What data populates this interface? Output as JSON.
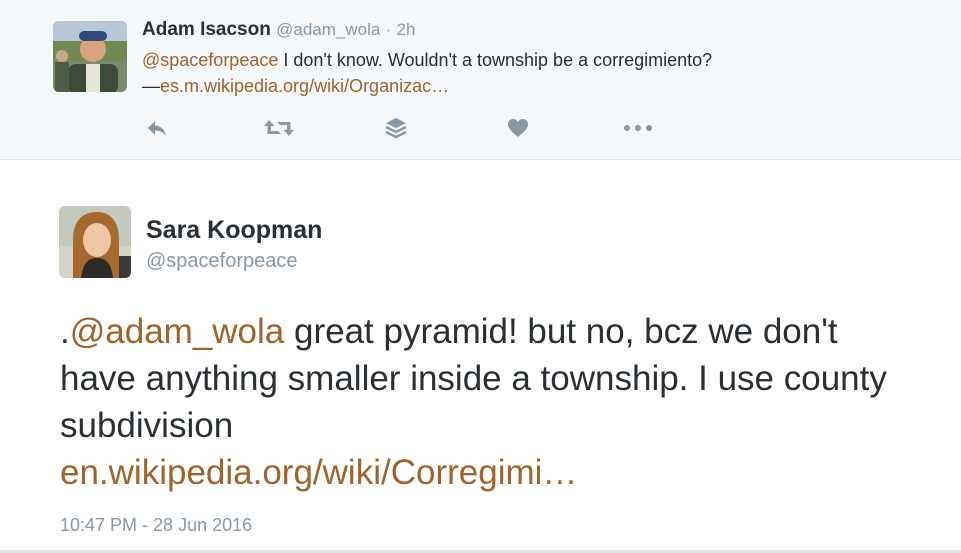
{
  "reply": {
    "name": "Adam Isacson",
    "handle": "@adam_wola",
    "separator": "·",
    "time": "2h",
    "mention": "@spaceforpeace",
    "text": " I don't know. Wouldn't a township be a corregimiento?",
    "dash": "—",
    "link": "es.m.wikipedia.org/wiki/Organizac…",
    "actions": [
      "reply-icon",
      "retweet-icon",
      "stack-icon",
      "like-icon",
      "more-icon"
    ]
  },
  "tweet": {
    "name": "Sara Koopman",
    "handle": "@spaceforpeace",
    "prefix": ".",
    "mention": "@adam_wola",
    "text": " great pyramid! but no, bcz we don't have anything smaller inside a township. I use county subdivision",
    "link": "en.wikipedia.org/wiki/Corregimi…",
    "timestamp": "10:47 PM - 28 Jun 2016"
  },
  "colors": {
    "link": "#a0632a",
    "muted": "#8899a6",
    "text": "#292f33",
    "reply_bg": "#f5f8fa",
    "icon": "#8899a6"
  }
}
